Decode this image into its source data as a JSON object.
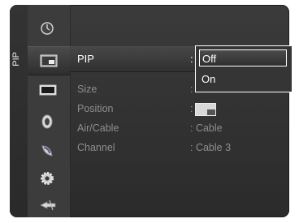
{
  "tab": {
    "label": "PIP"
  },
  "sidebar_icons": [
    {
      "name": "clock-icon"
    },
    {
      "name": "pip-icon"
    },
    {
      "name": "picture-icon"
    },
    {
      "name": "sound-icon"
    },
    {
      "name": "satellite-icon"
    },
    {
      "name": "setup-gear-icon"
    },
    {
      "name": "input-icon"
    }
  ],
  "menu": {
    "pip": {
      "label": "PIP",
      "value": ":"
    },
    "size": {
      "label": "Size",
      "value": ":"
    },
    "position": {
      "label": "Position",
      "value": ":"
    },
    "air_cable": {
      "label": "Air/Cable",
      "value": ": Cable"
    },
    "channel": {
      "label": "Channel",
      "value": ": Cable 3"
    }
  },
  "dropdown": {
    "options": [
      "Off",
      "On"
    ],
    "selected": "Off"
  },
  "colors": {
    "accent": "#ffffff",
    "dim_text": "#8e8e8e",
    "panel": "#353535"
  }
}
